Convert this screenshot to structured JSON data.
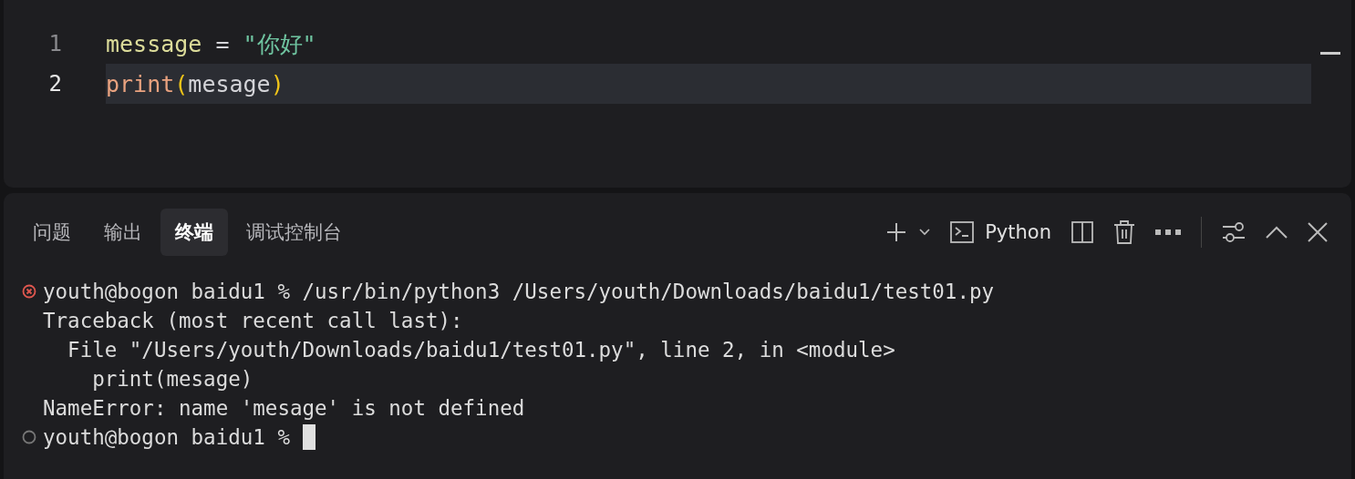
{
  "editor": {
    "lines": [
      {
        "number": "1",
        "current": false,
        "tokens": [
          {
            "kind": "variable",
            "text": "message"
          },
          {
            "kind": "plain",
            "text": " = "
          },
          {
            "kind": "string",
            "text": "\"你好\""
          }
        ]
      },
      {
        "number": "2",
        "current": true,
        "tokens": [
          {
            "kind": "function",
            "text": "print"
          },
          {
            "kind": "bracket",
            "text": "("
          },
          {
            "kind": "plain",
            "text": "mesage"
          },
          {
            "kind": "bracket",
            "text": ")"
          }
        ]
      }
    ]
  },
  "panel": {
    "tabs": [
      {
        "label": "问题",
        "selected": false
      },
      {
        "label": "输出",
        "selected": false
      },
      {
        "label": "终端",
        "selected": true
      },
      {
        "label": "调试控制台",
        "selected": false
      }
    ],
    "terminal_name": "Python"
  },
  "terminal": {
    "lines": [
      {
        "kind": "command",
        "failed": true,
        "text": "youth@bogon baidu1 % /usr/bin/python3 /Users/youth/Downloads/baidu1/test01.py",
        "cursor": false
      },
      {
        "kind": "output",
        "text": "Traceback (most recent call last):"
      },
      {
        "kind": "output",
        "text": "  File \"/Users/youth/Downloads/baidu1/test01.py\", line 2, in <module>"
      },
      {
        "kind": "output",
        "text": "    print(mesage)"
      },
      {
        "kind": "output",
        "text": "NameError: name 'mesage' is not defined"
      },
      {
        "kind": "command",
        "failed": false,
        "text": "youth@bogon baidu1 %",
        "cursor": true
      }
    ]
  }
}
